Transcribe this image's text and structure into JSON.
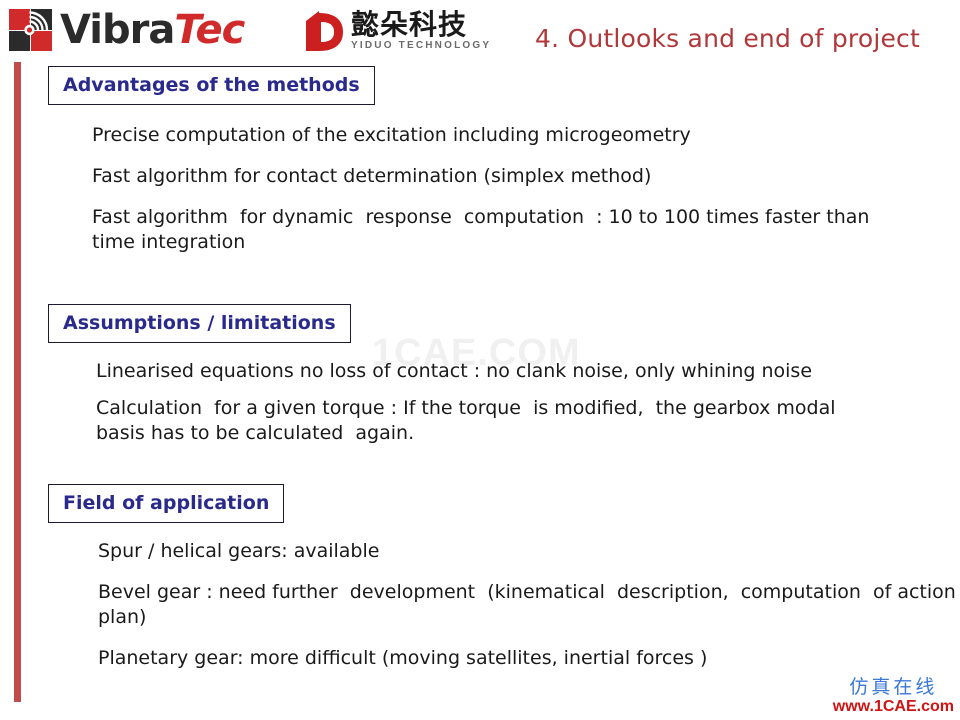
{
  "header": {
    "vibratec": {
      "name_part1": "Vibra",
      "name_part2": "Tec",
      "logo_icon": "vibratec-wave-mark"
    },
    "yiduo": {
      "name_cn": "懿朵科技",
      "name_en": "YIDUO TECHNOLOGY",
      "logo_icon": "yiduo-d-mark"
    },
    "title": "4. Outlooks and end of project"
  },
  "sections": [
    {
      "heading": "Advantages of the methods",
      "bullets": [
        "Precise computation  of the excitation  including  microgeometry",
        "Fast algorithm  for contact  determination  (simplex method)",
        "Fast algorithm  for dynamic  response  computation  : 10 to 100 times faster than time integration"
      ]
    },
    {
      "heading": "Assumptions  / limitations",
      "bullets": [
        "Linearised  equations  no loss of contact   : no clank noise,  only whining  noise",
        "Calculation  for a given torque : If the torque  is modified,  the gearbox modal basis has to be calculated  again."
      ]
    },
    {
      "heading": "Field of application",
      "bullets": [
        "Spur / helical  gears: available",
        "Bevel gear : need further  development  (kinematical  description,  computation  of action plan)",
        "Planetary  gear: more difficult  (moving satellites,  inertial  forces )"
      ]
    }
  ],
  "watermarks": {
    "center": "1CAE.COM",
    "corner_cn": "仿真在线",
    "corner_url": "www.1CAE.com"
  },
  "colors": {
    "title_red": "#b0383a",
    "accent_bar": "#c14a4a",
    "heading_blue": "#2a2a8c",
    "body_text": "#1a1a1a",
    "logo_red": "#d02a2a",
    "watermark_blue": "#3b78d8",
    "watermark_red": "#d01414"
  }
}
